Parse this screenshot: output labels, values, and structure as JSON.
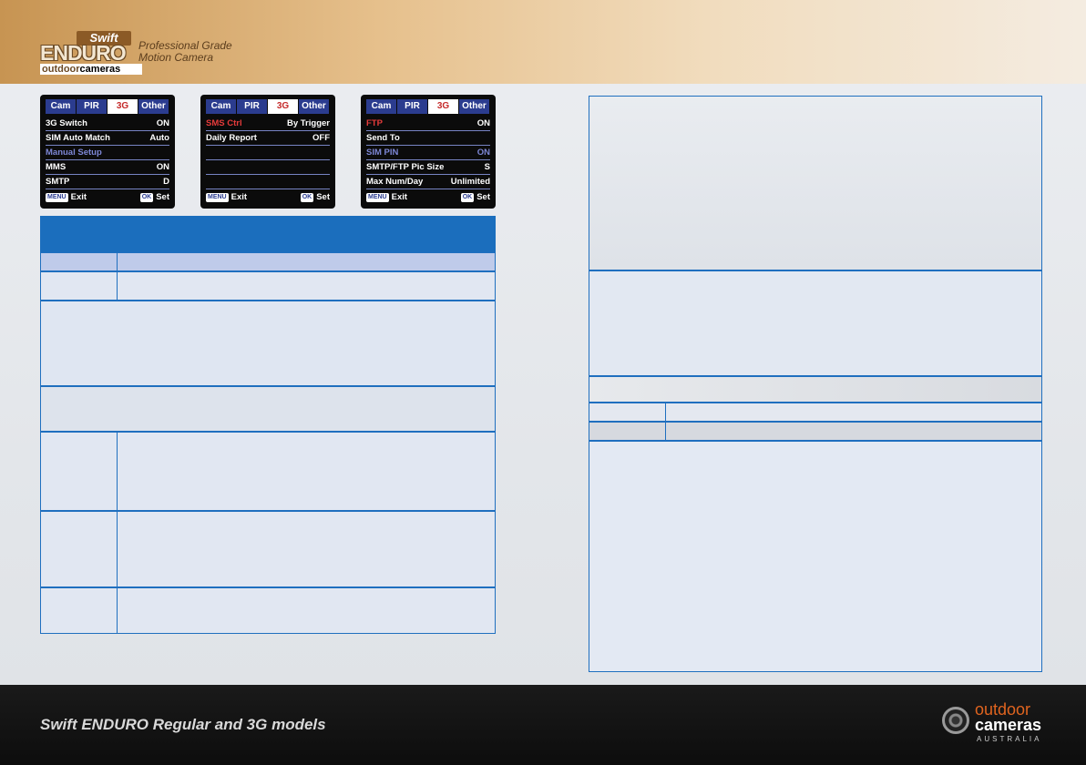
{
  "header": {
    "logo": {
      "swift": "Swift",
      "enduro": "ENDURO",
      "outdoor": "outdoor",
      "cameras": "cameras"
    },
    "tagline": [
      "Professional Grade",
      "Motion Camera"
    ]
  },
  "screens": [
    {
      "tabs": [
        "Cam",
        "PIR",
        "3G",
        "Other"
      ],
      "active_tab": 2,
      "rows": [
        {
          "label": "3G Switch",
          "value": "ON",
          "style": "normal"
        },
        {
          "label": "SIM Auto Match",
          "value": "Auto",
          "style": "normal"
        },
        {
          "label": "Manual Setup",
          "value": "",
          "style": "blue"
        },
        {
          "label": "MMS",
          "value": "ON",
          "style": "normal"
        },
        {
          "label": "SMTP",
          "value": "D",
          "style": "normal"
        }
      ],
      "footer": {
        "menu_key": "MENU",
        "exit": "Exit",
        "ok_key": "OK",
        "set": "Set"
      }
    },
    {
      "tabs": [
        "Cam",
        "PIR",
        "3G",
        "Other"
      ],
      "active_tab": 2,
      "rows": [
        {
          "label": "SMS Ctrl",
          "value": "By Trigger",
          "style": "red"
        },
        {
          "label": "Daily Report",
          "value": "OFF",
          "style": "normal"
        },
        {
          "label": "",
          "value": "",
          "style": "normal"
        },
        {
          "label": "",
          "value": "",
          "style": "normal"
        },
        {
          "label": "",
          "value": "",
          "style": "normal"
        }
      ],
      "footer": {
        "menu_key": "MENU",
        "exit": "Exit",
        "ok_key": "OK",
        "set": "Set"
      }
    },
    {
      "tabs": [
        "Cam",
        "PIR",
        "3G",
        "Other"
      ],
      "active_tab": 2,
      "rows": [
        {
          "label": "FTP",
          "value": "ON",
          "style": "red"
        },
        {
          "label": "Send To",
          "value": "",
          "style": "normal"
        },
        {
          "label": "SIM PIN",
          "value": "ON",
          "style": "blue"
        },
        {
          "label": "SMTP/FTP Pic Size",
          "value": "S",
          "style": "normal"
        },
        {
          "label": "Max Num/Day",
          "value": "Unlimited",
          "style": "normal"
        }
      ],
      "footer": {
        "menu_key": "MENU",
        "exit": "Exit",
        "ok_key": "OK",
        "set": "Set"
      }
    }
  ],
  "footer": {
    "title": "Swift ENDURO Regular and 3G models",
    "brand": {
      "outdoor": "outdoor",
      "cameras": "cameras",
      "country": "AUSTRALIA"
    }
  },
  "colors": {
    "accent_blue": "#1b6ebd",
    "table_border": "#1f6fbf",
    "header_gold": "#c79452",
    "brand_orange": "#e0641f"
  }
}
